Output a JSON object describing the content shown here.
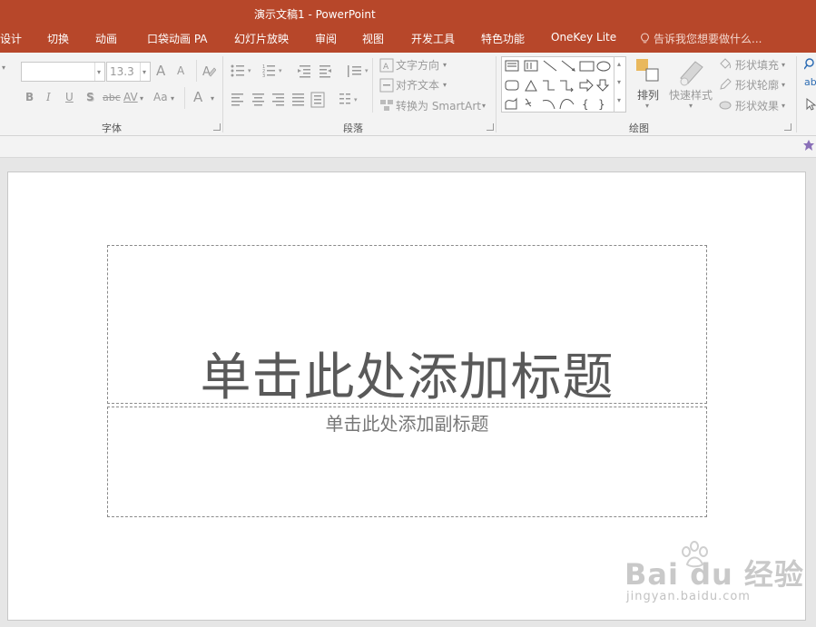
{
  "window": {
    "title": "演示文稿1 - PowerPoint"
  },
  "tabs": [
    {
      "label": "设计"
    },
    {
      "label": "切换"
    },
    {
      "label": "动画"
    },
    {
      "label": "口袋动画 PA"
    },
    {
      "label": "幻灯片放映"
    },
    {
      "label": "审阅"
    },
    {
      "label": "视图"
    },
    {
      "label": "开发工具"
    },
    {
      "label": "特色功能"
    },
    {
      "label": "OneKey Lite"
    }
  ],
  "tell_me": "告诉我您想要做什么...",
  "ribbon": {
    "font_group": {
      "label": "字体",
      "font_name": "",
      "font_size": "13.3",
      "bold": "B",
      "italic": "I",
      "underline": "U",
      "shadow": "S",
      "strike": "abc",
      "spacing": "AV",
      "case": "Aa",
      "color": "A",
      "grow": "A",
      "shrink": "A"
    },
    "paragraph_group": {
      "label": "段落",
      "text_direction": "文字方向",
      "align_text": "对齐文本",
      "convert_smartart": "转换为 SmartArt"
    },
    "drawing_group": {
      "label": "绘图",
      "arrange": "排列",
      "quick_styles": "快速样式",
      "shape_fill": "形状填充",
      "shape_outline": "形状轮廓",
      "shape_effects": "形状效果"
    },
    "edit_group": {
      "ab": "ab"
    }
  },
  "slide": {
    "title_placeholder": "单击此处添加标题",
    "subtitle_placeholder": "单击此处添加副标题"
  },
  "watermark": {
    "brand": "Bai du 经验",
    "url": "jingyan.baidu.com"
  }
}
